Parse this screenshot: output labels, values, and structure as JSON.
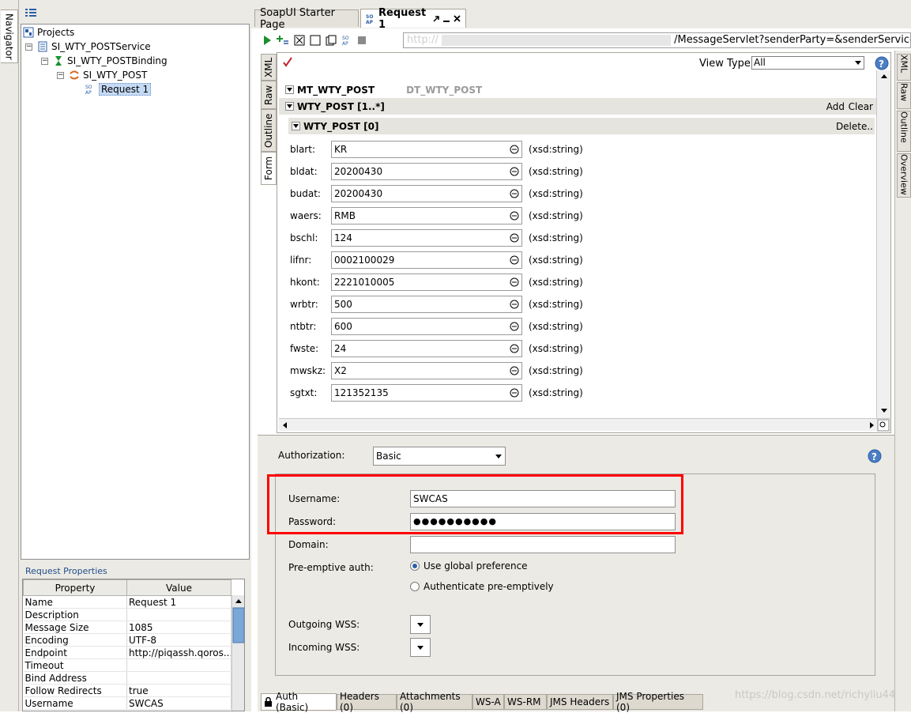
{
  "navigator": {
    "strip_label": "Navigator",
    "tree": {
      "projects": "Projects",
      "service": "SI_WTY_POSTService",
      "binding": "SI_WTY_POSTBinding",
      "operation": "SI_WTY_POST",
      "request": "Request 1"
    }
  },
  "properties": {
    "title": "Request Properties",
    "headers": [
      "Property",
      "Value"
    ],
    "rows": [
      {
        "name": "Name",
        "value": "Request 1"
      },
      {
        "name": "Description",
        "value": ""
      },
      {
        "name": "Message Size",
        "value": "1085"
      },
      {
        "name": "Encoding",
        "value": "UTF-8"
      },
      {
        "name": "Endpoint",
        "value": "http://piqassh.qoros..."
      },
      {
        "name": "Timeout",
        "value": ""
      },
      {
        "name": "Bind Address",
        "value": ""
      },
      {
        "name": "Follow Redirects",
        "value": "true"
      },
      {
        "name": "Username",
        "value": "SWCAS"
      }
    ]
  },
  "tabs": {
    "starter": "SoapUI Starter Page",
    "request": "Request 1"
  },
  "request": {
    "endpoint_prefix": "http://",
    "endpoint": "/MessageServlet?senderParty=&senderService=SWCASC"
  },
  "editor": {
    "vtabs": [
      "XML",
      "Raw",
      "Outline",
      "Form"
    ],
    "view_type_label": "View Type:",
    "view_type_value": "All",
    "root_element": "MT_WTY_POST",
    "root_type": "DT_WTY_POST",
    "list_element": "WTY_POST [1..*]",
    "add_label": "Add",
    "clear_label": "Clear",
    "item_element": "WTY_POST [0]",
    "delete_label": "Delete..",
    "fields": [
      {
        "name": "blart:",
        "value": "KR",
        "type": "(xsd:string)"
      },
      {
        "name": "bldat:",
        "value": "20200430",
        "type": "(xsd:string)"
      },
      {
        "name": "budat:",
        "value": "20200430",
        "type": "(xsd:string)"
      },
      {
        "name": "waers:",
        "value": "RMB",
        "type": "(xsd:string)"
      },
      {
        "name": "bschl:",
        "value": "124",
        "type": "(xsd:string)"
      },
      {
        "name": "lifnr:",
        "value": "0002100029",
        "type": "(xsd:string)"
      },
      {
        "name": "hkont:",
        "value": "2221010005",
        "type": "(xsd:string)"
      },
      {
        "name": "wrbtr:",
        "value": "500",
        "type": "(xsd:string)"
      },
      {
        "name": "ntbtr:",
        "value": "600",
        "type": "(xsd:string)"
      },
      {
        "name": "fwste:",
        "value": "24",
        "type": "(xsd:string)"
      },
      {
        "name": "mwskz:",
        "value": "X2",
        "type": "(xsd:string)"
      },
      {
        "name": "sgtxt:",
        "value": "121352135",
        "type": "(xsd:string)"
      }
    ]
  },
  "auth": {
    "authorization_label": "Authorization:",
    "authorization_value": "Basic",
    "username_label": "Username:",
    "username_value": "SWCAS",
    "password_label": "Password:",
    "password_value": "●●●●●●●●●●",
    "domain_label": "Domain:",
    "domain_value": "",
    "preemptive_label": "Pre-emptive auth:",
    "option_global": "Use global preference",
    "option_preemptive": "Authenticate pre-emptively",
    "outgoing_wss_label": "Outgoing WSS:",
    "incoming_wss_label": "Incoming WSS:"
  },
  "bottom_tabs": [
    "Auth (Basic)",
    "Headers (0)",
    "Attachments (0)",
    "WS-A",
    "WS-RM",
    "JMS Headers",
    "JMS Properties (0)"
  ],
  "right_tabs": [
    "XML",
    "Raw",
    "Outline",
    "Overview"
  ],
  "watermark": "https://blog.csdn.net/richyliu44",
  "colors": {
    "highlight_box": "#ff0000",
    "selection": "#c5dbf5",
    "link_blue": "#1f4d8c"
  }
}
